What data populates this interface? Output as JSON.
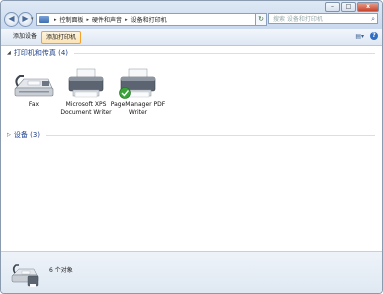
{
  "window": {
    "controls": {
      "minimize": "–",
      "maximize": "□",
      "close": "x"
    }
  },
  "nav": {
    "back": "◀",
    "forward": "▶",
    "breadcrumbs": [
      "控制面板",
      "硬件和声音",
      "设备和打印机"
    ],
    "refresh": "↻",
    "search_placeholder": "搜索 设备和打印机"
  },
  "toolbar": {
    "add_device": "添加设备",
    "add_printer": "添加打印机"
  },
  "groups": {
    "printers": {
      "title": "打印机和传真 (4)"
    },
    "devices": {
      "title": "设备 (3)"
    }
  },
  "printers": [
    {
      "label": "Fax",
      "default": false
    },
    {
      "label": "Microsoft XPS Document Writer",
      "default": false
    },
    {
      "label": "PageManager PDF Writer",
      "default": true
    }
  ],
  "details": {
    "count": "6 个对象"
  }
}
